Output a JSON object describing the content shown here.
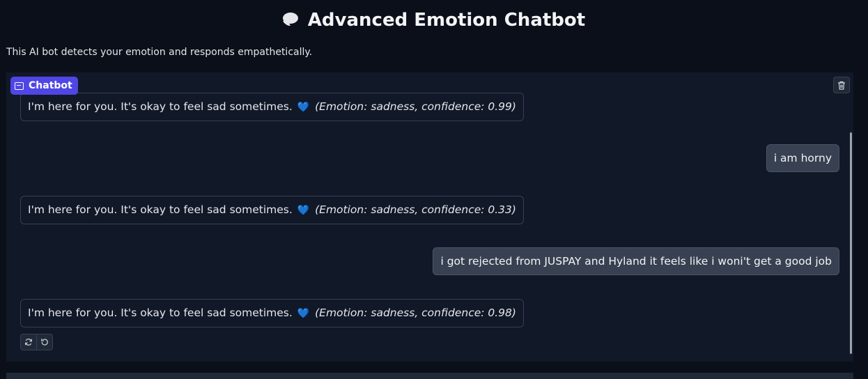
{
  "header": {
    "icon": "speech-bubble-icon",
    "title": "Advanced Emotion Chatbot",
    "subtitle": "This AI bot detects your emotion and responds empathetically."
  },
  "chatbot": {
    "label": "Chatbot",
    "label_icon": "chat-icon",
    "clear_icon": "trash-icon",
    "messages": [
      {
        "role": "bot",
        "text": "I'm here for you. It's okay to feel sad sometimes.",
        "emoji": "💙",
        "meta": "(Emotion: sadness, confidence: 0.99)"
      },
      {
        "role": "user",
        "text": "i am horny"
      },
      {
        "role": "bot",
        "text": "I'm here for you. It's okay to feel sad sometimes.",
        "emoji": "💙",
        "meta": "(Emotion: sadness, confidence: 0.33)"
      },
      {
        "role": "user",
        "text": "i got rejected from JUSPAY and Hyland it feels like i woni't get a good job"
      },
      {
        "role": "bot",
        "text": "I'm here for you. It's okay to feel sad sometimes.",
        "emoji": "💙",
        "meta": "(Emotion: sadness, confidence: 0.98)"
      }
    ],
    "actions": [
      "retry-icon",
      "undo-icon"
    ]
  },
  "colors": {
    "background": "#0b0f19",
    "panel": "#111827",
    "accent": "#4f46e5",
    "user_bubble": "#374151"
  }
}
